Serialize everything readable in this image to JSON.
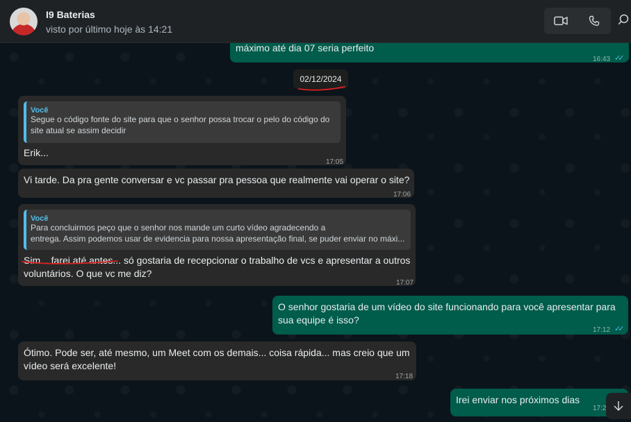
{
  "header": {
    "contact_name": "I9 Baterias",
    "status": "visto por último hoje às 14:21",
    "icons": {
      "video": "video-camera-icon",
      "call": "phone-icon",
      "search": "search-icon"
    }
  },
  "date_separator": "02/12/2024",
  "colors": {
    "incoming": "#292929",
    "outgoing": "#005c4b",
    "quote_accent": "#53bdeb",
    "annotation": "#e02020"
  },
  "messages": [
    {
      "direction": "out",
      "lines": [
        "máximo até dia 07 seria perfeito"
      ],
      "time": "16:43",
      "read": true
    },
    {
      "direction": "in",
      "quote": {
        "author": "Você",
        "lines": [
          "Segue o código fonte do site para que o senhor possa trocar o pelo do código do",
          "site atual se assim decidir"
        ]
      },
      "lines": [
        "Erik..."
      ],
      "time": "17:05"
    },
    {
      "direction": "in",
      "lines": [
        "Vi tarde. Da pra gente conversar e vc passar pra pessoa que realmente vai operar o site?"
      ],
      "time": "17:06"
    },
    {
      "direction": "in",
      "quote": {
        "author": "Você",
        "lines": [
          "Para concluirmos peço que o senhor nos mande um curto vídeo agradecendo a",
          "entrega. Assim podemos usar de evidencia para nossa apresentação final, se puder enviar no máxi..."
        ]
      },
      "lines": [
        "Sim... farei até antes... só gostaria de recepcionar o trabalho de vcs e apresentar a outros",
        "voluntários. O que vc me diz?"
      ],
      "time": "17:07"
    },
    {
      "direction": "out",
      "lines": [
        "O senhor gostaria de um vídeo do site funcionando para você apresentar para",
        "sua equipe é isso?"
      ],
      "time": "17:12",
      "read": true
    },
    {
      "direction": "in",
      "lines": [
        "Ótimo. Pode ser, até mesmo, um Meet com os demais... coisa rápida... mas creio que um",
        "vídeo será excelente!"
      ],
      "time": "17:18"
    },
    {
      "direction": "out",
      "lines": [
        "Irei enviar nos próximos dias"
      ],
      "time": "17:2"
    }
  ],
  "read_ticks": "✓✓"
}
